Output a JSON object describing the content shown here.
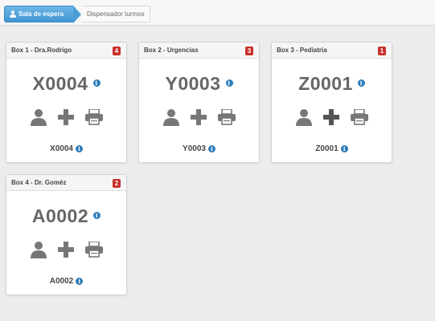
{
  "breadcrumb": {
    "active_label": "Sala de espera",
    "next_label": "Dispensador turmos"
  },
  "boxes": [
    {
      "title": "Box 1 - Dra.Rodrigo",
      "badge": "4",
      "current": "X0004",
      "last": "X0004"
    },
    {
      "title": "Box 2 - Urgencias",
      "badge": "3",
      "current": "Y0003",
      "last": "Y0003"
    },
    {
      "title": "Box 3 - Pediatria",
      "badge": "1",
      "current": "Z0001",
      "last": "Z0001"
    },
    {
      "title": "Box 4 - Dr. Goméz",
      "badge": "2",
      "current": "A0002",
      "last": "A0002"
    }
  ],
  "info_glyph": "i",
  "colors": {
    "accent": "#3f95d1",
    "badge": "#c9302c",
    "info": "#2c7cb9",
    "icon": "#777777"
  }
}
